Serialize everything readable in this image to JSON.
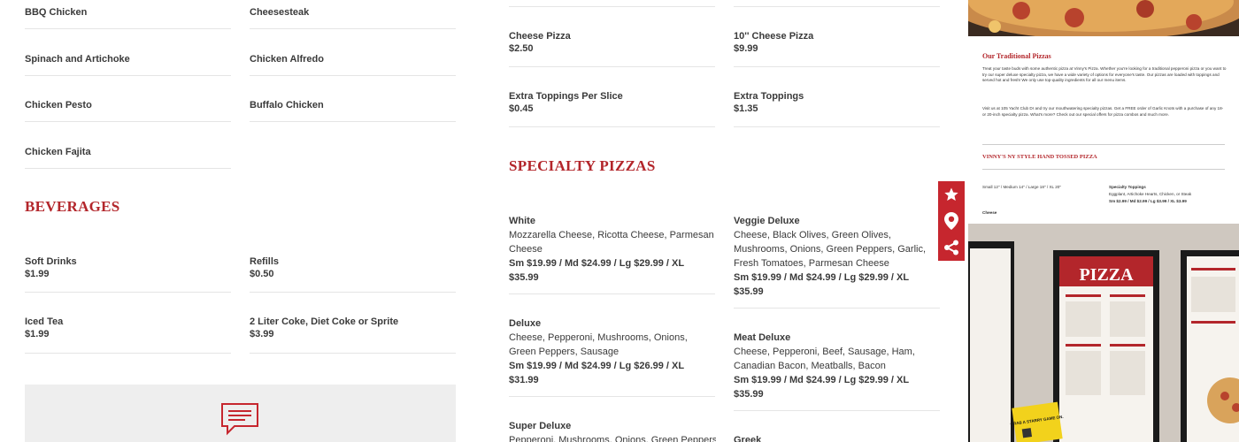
{
  "left_col1": [
    {
      "name": "BBQ Chicken"
    },
    {
      "name": "Spinach and Artichoke"
    },
    {
      "name": "Chicken Pesto"
    },
    {
      "name": "Chicken Fajita"
    }
  ],
  "left_col2": [
    {
      "name": "Cheesesteak"
    },
    {
      "name": "Chicken Alfredo"
    },
    {
      "name": "Buffalo Chicken"
    }
  ],
  "beverages": {
    "heading": "BEVERAGES",
    "items": [
      {
        "name": "Soft Drinks",
        "price": "$1.99"
      },
      {
        "name": "Refills",
        "price": "$0.50"
      },
      {
        "name": "Iced Tea",
        "price": "$1.99"
      },
      {
        "name": "2 Liter Coke, Diet Coke or Sprite",
        "price": "$3.99"
      }
    ]
  },
  "slices": [
    {
      "name": "Cheese Pizza",
      "price": "$2.50"
    },
    {
      "name": "10'' Cheese Pizza",
      "price": "$9.99"
    },
    {
      "name": "Extra Toppings Per Slice",
      "price": "$0.45"
    },
    {
      "name": "Extra Toppings",
      "price": "$1.35"
    }
  ],
  "specialty": {
    "heading": "SPECIALTY PIZZAS",
    "items": [
      {
        "name": "White",
        "desc": "Mozzarella Cheese, Ricotta Cheese, Parmesan Cheese",
        "prices": "Sm $19.99 / Md $24.99 / Lg $29.99 / XL $35.99"
      },
      {
        "name": "Veggie Deluxe",
        "desc": "Cheese, Black Olives, Green Olives, Mushrooms, Onions, Green Peppers, Garlic, Fresh Tomatoes, Parmesan Cheese",
        "prices": "Sm $19.99 / Md $24.99 / Lg $29.99 / XL $35.99"
      },
      {
        "name": "Deluxe",
        "desc": "Cheese, Pepperoni, Mushrooms, Onions, Green Peppers, Sausage",
        "prices": "Sm $19.99 / Md $24.99 / Lg $26.99 / XL $31.99"
      },
      {
        "name": "Meat Deluxe",
        "desc": "Cheese, Pepperoni, Beef, Sausage, Ham, Canadian Bacon, Meatballs, Bacon",
        "prices": "Sm $19.99 / Md $24.99 / Lg $29.99 / XL $35.99"
      },
      {
        "name": "Super Deluxe",
        "desc": "Pepperoni, Mushrooms, Onions, Green Peppers",
        "prices": ""
      },
      {
        "name": "Greek",
        "desc": "",
        "prices": ""
      }
    ]
  },
  "sidebar_icons": [
    "star-icon",
    "location-pin-icon",
    "share-icon"
  ],
  "menu_doc": {
    "title": "Our Traditional Pizzas",
    "para1": "Treat your taste buds with some authentic pizza at Vinny's Pizza. Whether you're looking for a traditional pepperoni pizza or you want to try our super deluxe specialty pizza, we have a wide variety of options for everyone's taste. Our pizzas are loaded with toppings and served hot and fresh! We only use top-quality ingredients for all our menu items.",
    "para2": "Visit us at 105 Yacht Club Dr and try our mouthwatering specialty pizzas. Get a FREE order of Garlic Knots with a purchase of any 18- or 20-inch specialty pizza. What's more? Check out our special offers for pizza combos and much more.",
    "section": "VINNY'S NY STYLE HAND TOSSED PIZZA",
    "sizes": "Small 12'' / Medium 14'' / Large 18'' / XL 20''",
    "toppings_title": "Specialty Toppings",
    "toppings": "Eggplant, Artichoke Hearts, Chicken, or Steak",
    "toppings_prices": "Sm $2.99 / Md $2.99 / Lg $3.99 / XL $3.99",
    "cheese": "Cheese"
  },
  "photo_board": {
    "sign": "PIZZA",
    "promo": "GRAB A STARRY GAME ON."
  },
  "colors": {
    "accent": "#b3262b",
    "sidebar_red": "#c6262e"
  }
}
